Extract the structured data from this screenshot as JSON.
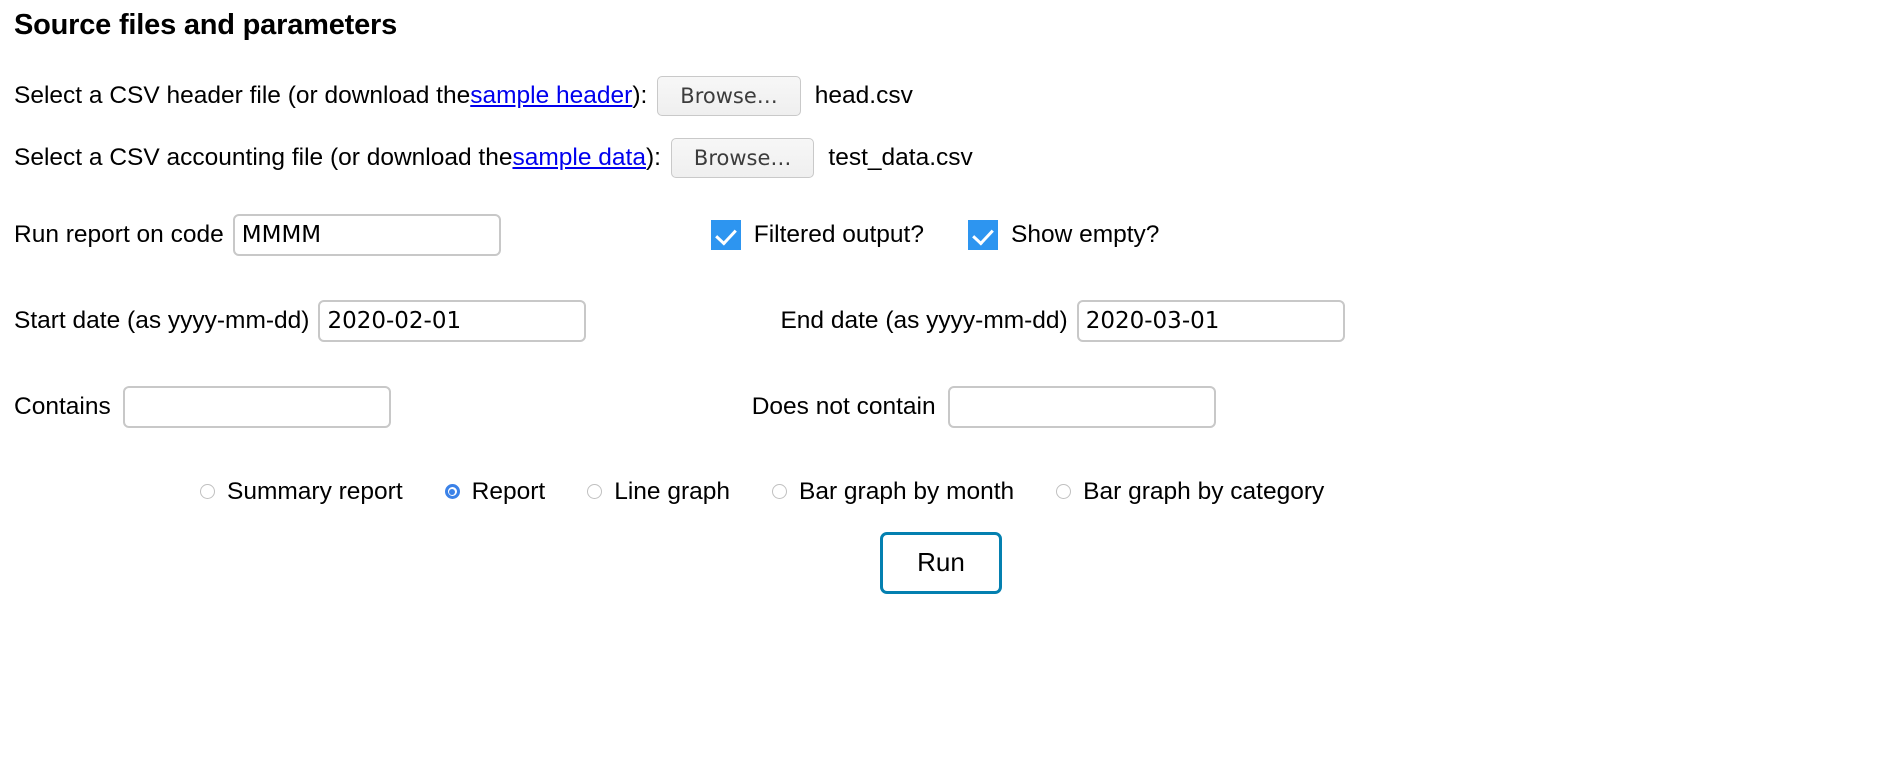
{
  "page": {
    "title": "Source files and parameters"
  },
  "header_file_row": {
    "label_before": "Select a CSV header file (or download the ",
    "link_text": "sample header",
    "label_after": "):",
    "browse_label": "Browse…",
    "filename": "head.csv"
  },
  "data_file_row": {
    "label_before": "Select a CSV accounting file (or download the ",
    "link_text": "sample data",
    "label_after": "):",
    "browse_label": "Browse…",
    "filename": "test_data.csv"
  },
  "code_row": {
    "label": "Run report on code",
    "value": "MMMM"
  },
  "checkboxes": [
    {
      "label": "Filtered output?",
      "checked": true
    },
    {
      "label": "Show empty?",
      "checked": true
    }
  ],
  "date_row": {
    "start_label": "Start date (as yyyy-mm-dd)",
    "start_value": "2020-02-01",
    "end_label": "End date (as yyyy-mm-dd)",
    "end_value": "2020-03-01"
  },
  "filter_row": {
    "contains_label": "Contains",
    "contains_value": "",
    "not_contains_label": "Does not contain",
    "not_contains_value": ""
  },
  "report_types": [
    {
      "label": "Summary report",
      "selected": false
    },
    {
      "label": "Report",
      "selected": true
    },
    {
      "label": "Line graph",
      "selected": false
    },
    {
      "label": "Bar graph by month",
      "selected": false
    },
    {
      "label": "Bar graph by category",
      "selected": false
    }
  ],
  "run": {
    "label": "Run"
  },
  "colors": {
    "link": "#0000EE",
    "checkbox_accent": "#2D95F0",
    "radio_accent": "#3B82E8",
    "run_border": "#0480B0"
  }
}
